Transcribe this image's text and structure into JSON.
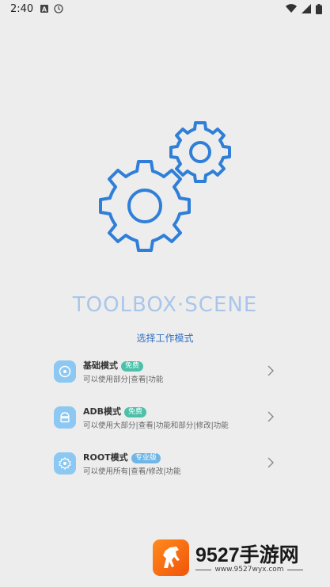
{
  "status_bar": {
    "time": "2:40",
    "left_icons": [
      "a-badge-icon",
      "clock-icon"
    ],
    "right_icons": [
      "wifi-icon",
      "signal-icon",
      "battery-icon"
    ]
  },
  "app": {
    "title": "TOOLBOX·SCENE",
    "subtitle": "选择工作模式",
    "logo_icon": "gears-icon",
    "accent_color": "#2f7fd9",
    "title_color": "#a9c6ea"
  },
  "modes": [
    {
      "name": "基础模式",
      "badge": "免费",
      "badge_color": "#4cc0a8",
      "desc": "可以使用部分|查看|功能",
      "icon": "disc-icon"
    },
    {
      "name": "ADB模式",
      "badge": "免费",
      "badge_color": "#4cc0a8",
      "desc": "可以使用大部分|查看|功能和部分|修改|功能",
      "icon": "android-icon"
    },
    {
      "name": "ROOT模式",
      "badge": "专业版",
      "badge_color": "#6fb6e6",
      "desc": "可以使用所有|查看/修改|功能",
      "icon": "seal-icon"
    }
  ],
  "watermark": {
    "brand": "9527手游网",
    "url": "www.9527wyx.com",
    "logo_icon": "horse-logo-icon"
  }
}
